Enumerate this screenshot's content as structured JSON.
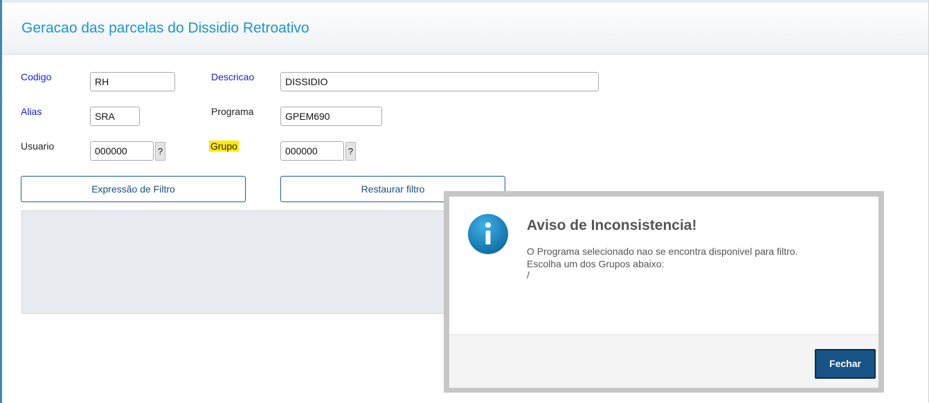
{
  "header": {
    "title": "Geracao das parcelas do Dissidio Retroativo"
  },
  "form": {
    "codigo": {
      "label": "Codigo",
      "value": "RH"
    },
    "descricao": {
      "label": "Descricao",
      "value": "DISSIDIO"
    },
    "alias": {
      "label": "Alias",
      "value": "SRA"
    },
    "programa": {
      "label": "Programa",
      "value": "GPEM690"
    },
    "usuario": {
      "label": "Usuario",
      "value": "000000",
      "lookup": "?"
    },
    "grupo": {
      "label": "Grupo",
      "value": "000000",
      "lookup": "?"
    }
  },
  "buttons": {
    "filter_expression": "Expressão de Filtro",
    "restore_filter": "Restaurar filtro"
  },
  "dialog": {
    "title": "Aviso de Inconsistencia!",
    "line1": "O Programa selecionado nao se encontra disponivel para filtro.",
    "line2": "Escolha um dos Grupos abaixo:",
    "line3": "/",
    "close_label": "Fechar"
  },
  "colors": {
    "title": "#1a97c8",
    "primary": "#175387",
    "highlight": "#ffea00",
    "info_icon": "#1a86c0"
  },
  "icons": {
    "dialog": "info-icon"
  }
}
